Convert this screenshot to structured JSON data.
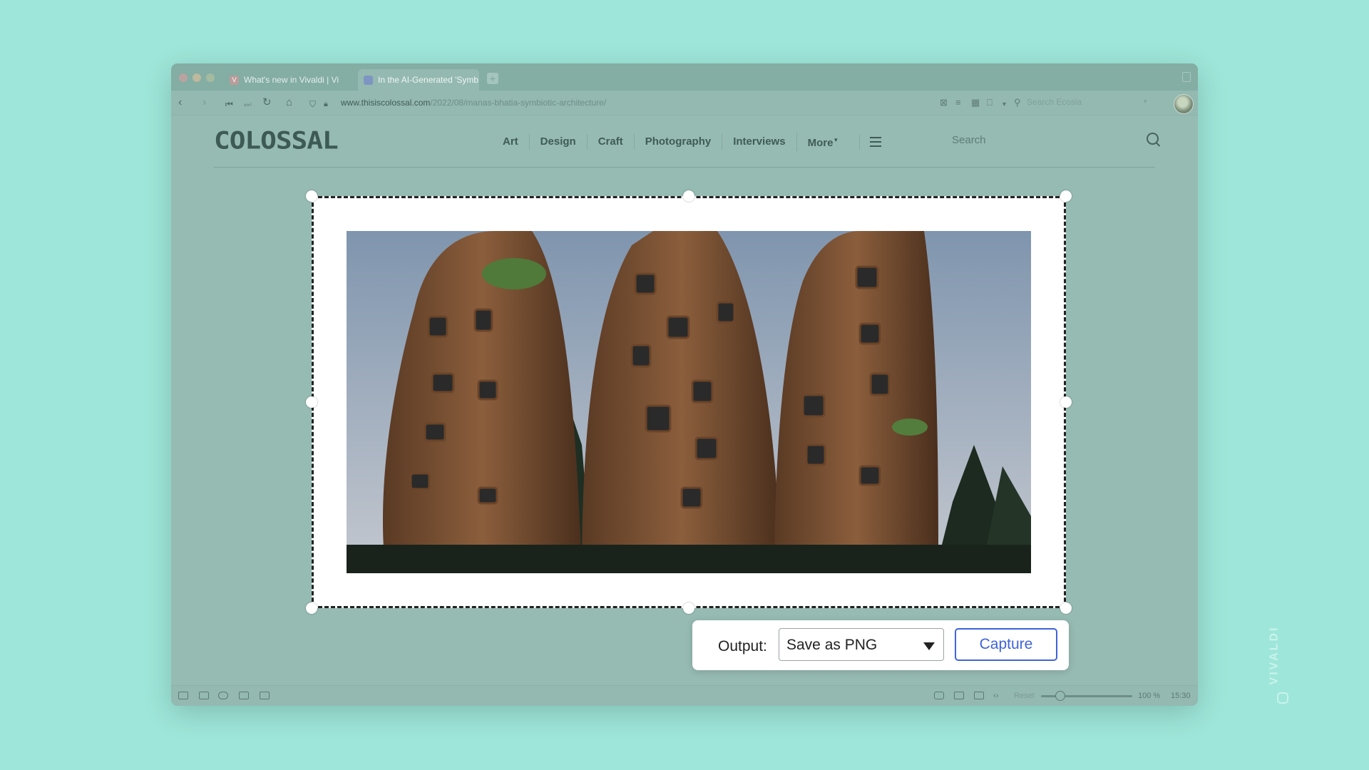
{
  "browser": {
    "tabs": [
      {
        "title": "What's new in Vivaldi | Vi",
        "active": false
      },
      {
        "title": "In the AI-Generated 'Symb",
        "active": true
      }
    ],
    "url_host": "www.thisiscolossal.com",
    "url_path": "/2022/08/manas-bhatia-symbiotic-architecture/",
    "search_placeholder": "Search Ecosia"
  },
  "site": {
    "logo": "COLOSSAL",
    "nav": [
      "Art",
      "Design",
      "Craft",
      "Photography",
      "Interviews",
      "More"
    ],
    "search_placeholder": "Search"
  },
  "capture": {
    "output_label": "Output:",
    "output_value": "Save as PNG",
    "capture_button": "Capture"
  },
  "statusbar": {
    "reset": "Reset",
    "zoom": "100 %",
    "time": "15:30"
  },
  "watermark": "VIVALDI",
  "colors": {
    "page_background": "#9ee6d9",
    "window_tint": "#96bbb3",
    "capture_accent": "#3f64d8"
  }
}
